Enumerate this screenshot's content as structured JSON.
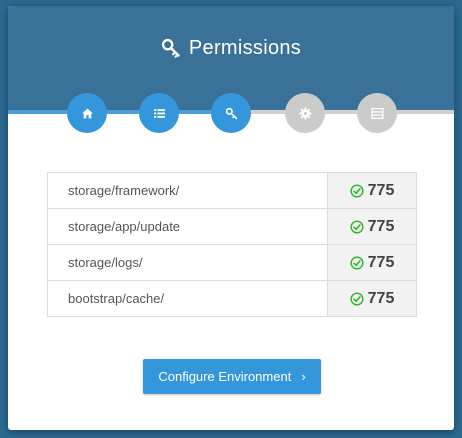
{
  "header": {
    "title": "Permissions",
    "icon": "key-icon"
  },
  "steps": [
    {
      "icon": "home-icon",
      "state": "complete"
    },
    {
      "icon": "list-icon",
      "state": "complete"
    },
    {
      "icon": "key-icon",
      "state": "current"
    },
    {
      "icon": "gear-icon",
      "state": "pending"
    },
    {
      "icon": "server-icon",
      "state": "pending"
    }
  ],
  "permissions": [
    {
      "path": "storage/framework/",
      "value": "775",
      "status": "ok"
    },
    {
      "path": "storage/app/update",
      "value": "775",
      "status": "ok"
    },
    {
      "path": "storage/logs/",
      "value": "775",
      "status": "ok"
    },
    {
      "path": "bootstrap/cache/",
      "value": "775",
      "status": "ok"
    }
  ],
  "action": {
    "label": "Configure Environment",
    "chevron": "›"
  },
  "colors": {
    "accent": "#3497dc",
    "header": "#3a7198",
    "background": "#2b6890",
    "ok": "#2eb82e",
    "inactive": "#cbcbcb"
  }
}
